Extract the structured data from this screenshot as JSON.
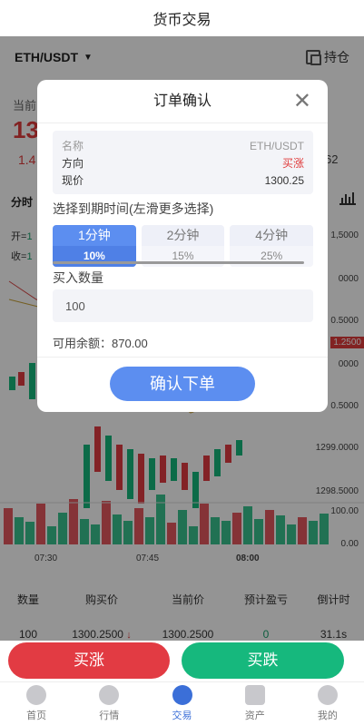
{
  "header": {
    "title": "货币交易"
  },
  "market": {
    "pair": "ETH/USDT",
    "hold_label": "持仓",
    "current_label": "当前",
    "current_price_partial": "13",
    "change_partial": "1.4",
    "right_partial": "62",
    "interval_label": "分时",
    "ohlc_open_label": "开=",
    "ohlc_open_partial": "1",
    "ohlc_close_label": "收=",
    "ohlc_close_partial": "1"
  },
  "chart_data": {
    "type": "candlestick",
    "y_ticks": [
      "1,5000",
      "0000",
      "0.5000",
      "0000",
      "0.5000",
      "1299.0000",
      "1298.5000"
    ],
    "current_price_tag": "1.2500",
    "volume_ticks": [
      "100.00",
      "0.00"
    ],
    "x_ticks": [
      "07:30",
      "07:45",
      "08:00"
    ]
  },
  "orders_table": {
    "headers": [
      "数量",
      "购买价",
      "当前价",
      "预计盈亏",
      "倒计时"
    ],
    "rows": [
      {
        "qty": "100",
        "buy_price": "1300.2500",
        "current_price": "1300.2500",
        "pnl": "0",
        "countdown": "31.1s"
      }
    ]
  },
  "modal": {
    "title": "订单确认",
    "info": {
      "name_label": "名称",
      "name_value": "ETH/USDT",
      "direction_label": "方向",
      "direction_value": "买涨",
      "price_label": "现价",
      "price_value": "1300.25"
    },
    "expiry_label": "选择到期时间(左滑更多选择)",
    "durations": [
      {
        "label": "1分钟",
        "rate": "10%",
        "active": true
      },
      {
        "label": "2分钟",
        "rate": "15%",
        "active": false
      },
      {
        "label": "4分钟",
        "rate": "25%",
        "active": false
      }
    ],
    "quantity_label": "买入数量",
    "quantity_value": "100",
    "balance_text": "可用余额：870.00",
    "confirm_label": "确认下单"
  },
  "actions": {
    "buy_up": "买涨",
    "buy_down": "买跌"
  },
  "tabbar": [
    "首页",
    "行情",
    "交易",
    "资产",
    "我的"
  ],
  "colors": {
    "accent": "#5c8ef0",
    "up": "#e23b43",
    "down": "#16b87d",
    "active_tab": "#3b6fd8"
  }
}
